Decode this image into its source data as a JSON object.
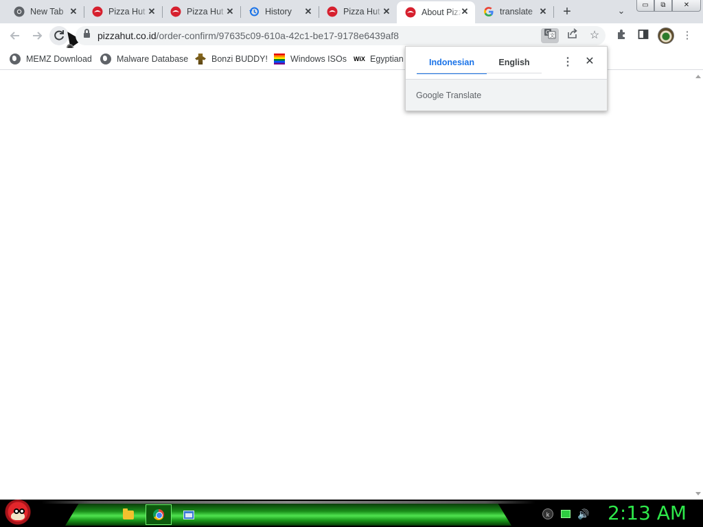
{
  "browser": {
    "tabs": [
      {
        "title": "New Tab",
        "favicon": "chrome-icon",
        "active": false
      },
      {
        "title": "Pizza Hut",
        "favicon": "pizza-hut-icon",
        "active": false
      },
      {
        "title": "Pizza Hut",
        "favicon": "pizza-hut-icon",
        "active": false
      },
      {
        "title": "History",
        "favicon": "history-icon",
        "active": false
      },
      {
        "title": "Pizza Hut",
        "favicon": "pizza-hut-icon",
        "active": false
      },
      {
        "title": "About Pizza",
        "favicon": "pizza-hut-icon",
        "active": true
      },
      {
        "title": "translate",
        "favicon": "google-icon",
        "active": false
      }
    ],
    "new_tab_glyph": "+",
    "tab_search_glyph": "⌄",
    "window_controls": {
      "minimize": "▭",
      "restore": "⧉",
      "close": "✕"
    },
    "address_bar": {
      "domain": "pizzahut.co.id",
      "path": "/order-confirm/97635c09-610a-42c1-be17-9178e6439af8"
    },
    "bookmarks": [
      {
        "label": "MEMZ Download",
        "icon": "globe-icon"
      },
      {
        "label": "Malware Database",
        "icon": "globe-icon"
      },
      {
        "label": "Bonzi BUDDY!",
        "icon": "bonzi-icon"
      },
      {
        "label": "Windows ISOs",
        "icon": "rainbow-flag-icon"
      },
      {
        "label": "Egyptian",
        "icon": "wix-icon",
        "icon_text": "WiX"
      }
    ]
  },
  "translate_bubble": {
    "source_language": "Indonesian",
    "target_language": "English",
    "active_language": "Indonesian",
    "footer_brand": "Google",
    "footer_product": "Translate"
  },
  "taskbar": {
    "clock": "2:13 AM",
    "items": [
      "folder-icon",
      "chrome-icon",
      "window-icon"
    ],
    "active_item": "chrome-icon"
  },
  "colors": {
    "accent": "#1a73e8",
    "clock": "#2ee84a",
    "tabstrip": "#dee1e6",
    "pizza_hut_red": "#d6202e"
  }
}
